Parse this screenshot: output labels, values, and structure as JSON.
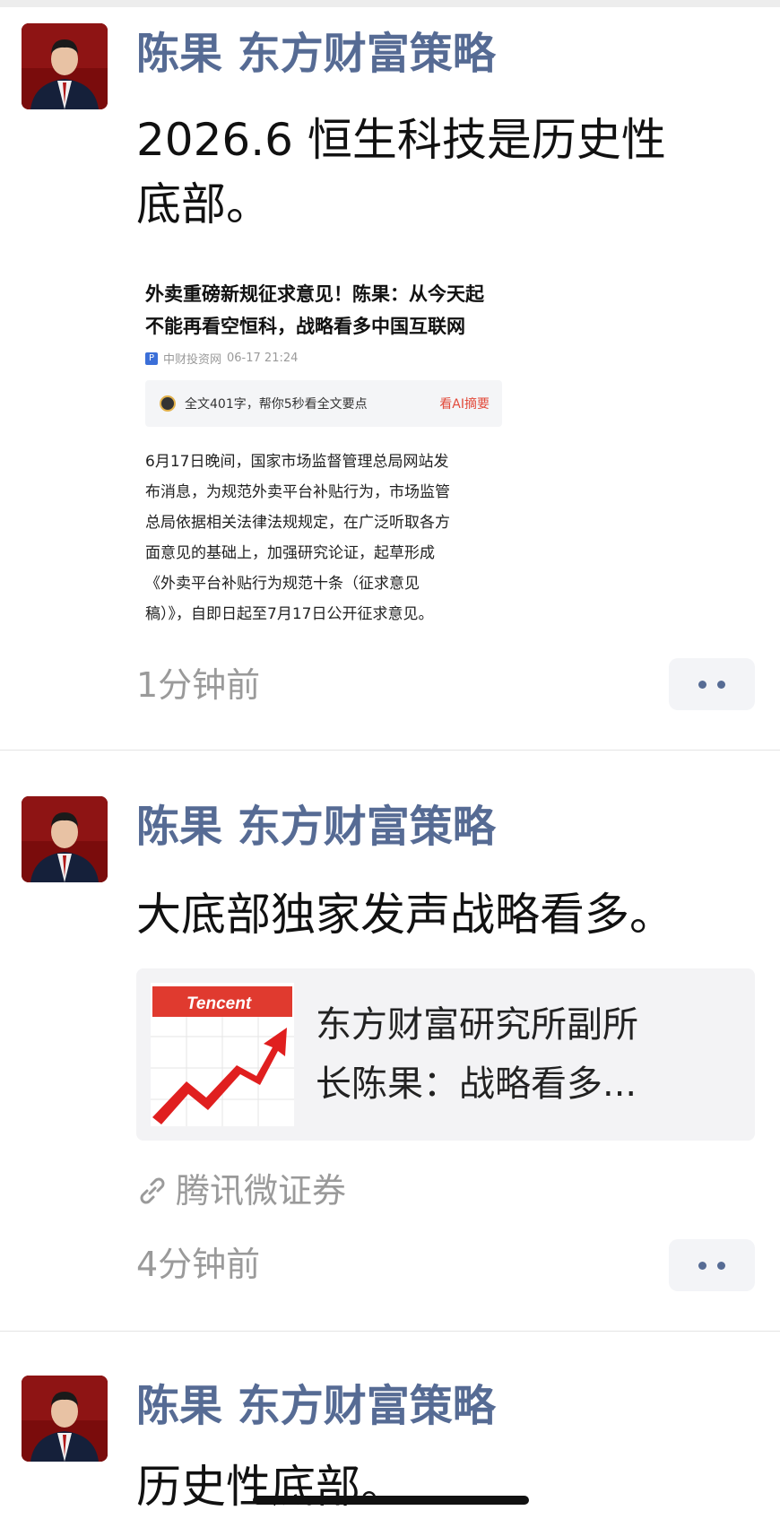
{
  "posts": [
    {
      "author": "陈果 东方财富策略",
      "text_lines": [
        "2026.6 恒生科技是历史性",
        "底部。"
      ],
      "article": {
        "title_lines": [
          "外卖重磅新规征求意见！陈果：从今天起",
          "不能再看空恒科，战略看多中国互联网"
        ],
        "source": "中财投资网",
        "date": "06-17 21:24",
        "ai_summary": "全文401字，帮你5秒看全文要点",
        "ai_link": "看AI摘要",
        "body_lines": [
          "6月17日晚间，国家市场监督管理总局网站发",
          "布消息，为规范外卖平台补贴行为，市场监管",
          "总局依据相关法律法规规定，在广泛听取各方",
          "面意见的基础上，加强研究论证，起草形成",
          "《外卖平台补贴行为规范十条（征求意见",
          "稿）》，自即日起至7月17日公开征求意见。"
        ]
      },
      "time": "1分钟前"
    },
    {
      "author": "陈果 东方财富策略",
      "text_lines": [
        "大底部独家发声战略看多。"
      ],
      "link_card": {
        "thumb_label": "Tencent",
        "title_lines": [
          "东方财富研究所副所",
          "长陈果：战略看多..."
        ]
      },
      "source": "腾讯微证券",
      "time": "4分钟前"
    },
    {
      "author": "陈果 东方财富策略",
      "text_lines": [
        "历史性底部。"
      ]
    }
  ],
  "colors": {
    "name": "#566b94",
    "meta": "#9a9a9a",
    "card_bg": "#f3f3f5",
    "ai_link": "#e24a3b"
  },
  "icons": [
    "more-icon",
    "link-icon",
    "ai-avatar-icon"
  ]
}
